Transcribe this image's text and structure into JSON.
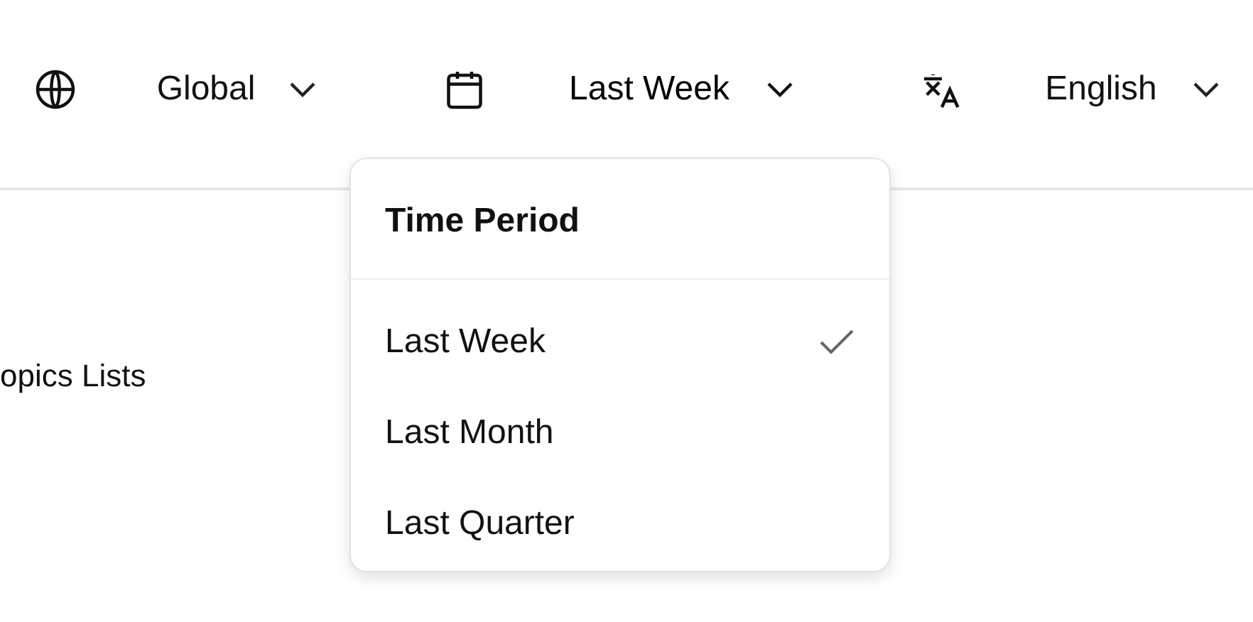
{
  "filters": [
    {
      "kind": "region",
      "label": "Global",
      "expanded": false
    },
    {
      "kind": "period",
      "label": "Last Week",
      "expanded": true
    },
    {
      "kind": "language",
      "label": "English",
      "expanded": false
    }
  ],
  "body_text": "opics Lists",
  "menu": {
    "title": "Time Period",
    "items": [
      {
        "label": "Last Week",
        "selected": true
      },
      {
        "label": "Last Month",
        "selected": false
      },
      {
        "label": "Last Quarter",
        "selected": false
      }
    ]
  }
}
